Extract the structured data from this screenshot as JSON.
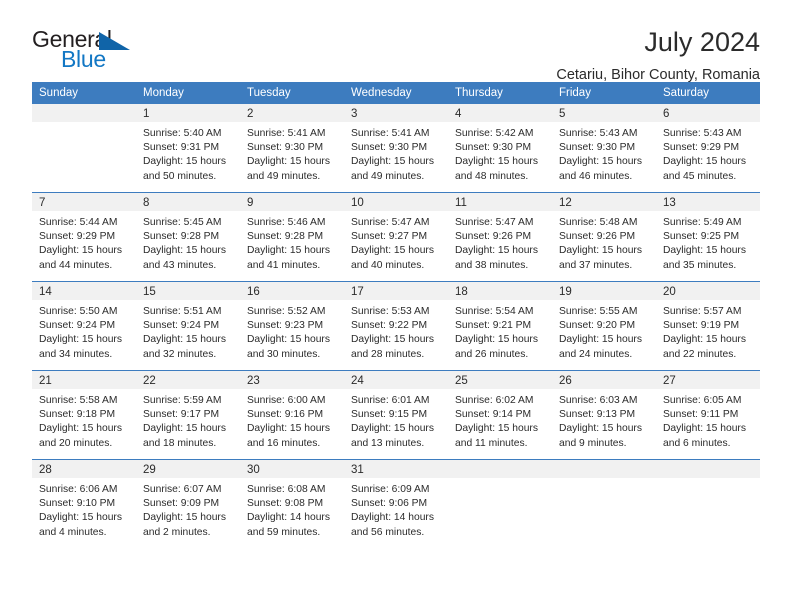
{
  "brand": {
    "name_part1": "General",
    "name_part2": "Blue",
    "accent_color": "#1277c4",
    "triangle_color": "#1064a8"
  },
  "header": {
    "title": "July 2024",
    "subtitle": "Cetariu, Bihor County, Romania"
  },
  "calendar": {
    "header_background": "#3d7cbf",
    "daynum_background": "#f1f1f1",
    "weekdays": [
      "Sunday",
      "Monday",
      "Tuesday",
      "Wednesday",
      "Thursday",
      "Friday",
      "Saturday"
    ],
    "weeks": [
      [
        {
          "day": "",
          "sunrise": "",
          "sunset": "",
          "daylight_line1": "",
          "daylight_line2": "",
          "empty": true
        },
        {
          "day": "1",
          "sunrise": "Sunrise: 5:40 AM",
          "sunset": "Sunset: 9:31 PM",
          "daylight_line1": "Daylight: 15 hours",
          "daylight_line2": "and 50 minutes."
        },
        {
          "day": "2",
          "sunrise": "Sunrise: 5:41 AM",
          "sunset": "Sunset: 9:30 PM",
          "daylight_line1": "Daylight: 15 hours",
          "daylight_line2": "and 49 minutes."
        },
        {
          "day": "3",
          "sunrise": "Sunrise: 5:41 AM",
          "sunset": "Sunset: 9:30 PM",
          "daylight_line1": "Daylight: 15 hours",
          "daylight_line2": "and 49 minutes."
        },
        {
          "day": "4",
          "sunrise": "Sunrise: 5:42 AM",
          "sunset": "Sunset: 9:30 PM",
          "daylight_line1": "Daylight: 15 hours",
          "daylight_line2": "and 48 minutes."
        },
        {
          "day": "5",
          "sunrise": "Sunrise: 5:43 AM",
          "sunset": "Sunset: 9:30 PM",
          "daylight_line1": "Daylight: 15 hours",
          "daylight_line2": "and 46 minutes."
        },
        {
          "day": "6",
          "sunrise": "Sunrise: 5:43 AM",
          "sunset": "Sunset: 9:29 PM",
          "daylight_line1": "Daylight: 15 hours",
          "daylight_line2": "and 45 minutes."
        }
      ],
      [
        {
          "day": "7",
          "sunrise": "Sunrise: 5:44 AM",
          "sunset": "Sunset: 9:29 PM",
          "daylight_line1": "Daylight: 15 hours",
          "daylight_line2": "and 44 minutes."
        },
        {
          "day": "8",
          "sunrise": "Sunrise: 5:45 AM",
          "sunset": "Sunset: 9:28 PM",
          "daylight_line1": "Daylight: 15 hours",
          "daylight_line2": "and 43 minutes."
        },
        {
          "day": "9",
          "sunrise": "Sunrise: 5:46 AM",
          "sunset": "Sunset: 9:28 PM",
          "daylight_line1": "Daylight: 15 hours",
          "daylight_line2": "and 41 minutes."
        },
        {
          "day": "10",
          "sunrise": "Sunrise: 5:47 AM",
          "sunset": "Sunset: 9:27 PM",
          "daylight_line1": "Daylight: 15 hours",
          "daylight_line2": "and 40 minutes."
        },
        {
          "day": "11",
          "sunrise": "Sunrise: 5:47 AM",
          "sunset": "Sunset: 9:26 PM",
          "daylight_line1": "Daylight: 15 hours",
          "daylight_line2": "and 38 minutes."
        },
        {
          "day": "12",
          "sunrise": "Sunrise: 5:48 AM",
          "sunset": "Sunset: 9:26 PM",
          "daylight_line1": "Daylight: 15 hours",
          "daylight_line2": "and 37 minutes."
        },
        {
          "day": "13",
          "sunrise": "Sunrise: 5:49 AM",
          "sunset": "Sunset: 9:25 PM",
          "daylight_line1": "Daylight: 15 hours",
          "daylight_line2": "and 35 minutes."
        }
      ],
      [
        {
          "day": "14",
          "sunrise": "Sunrise: 5:50 AM",
          "sunset": "Sunset: 9:24 PM",
          "daylight_line1": "Daylight: 15 hours",
          "daylight_line2": "and 34 minutes."
        },
        {
          "day": "15",
          "sunrise": "Sunrise: 5:51 AM",
          "sunset": "Sunset: 9:24 PM",
          "daylight_line1": "Daylight: 15 hours",
          "daylight_line2": "and 32 minutes."
        },
        {
          "day": "16",
          "sunrise": "Sunrise: 5:52 AM",
          "sunset": "Sunset: 9:23 PM",
          "daylight_line1": "Daylight: 15 hours",
          "daylight_line2": "and 30 minutes."
        },
        {
          "day": "17",
          "sunrise": "Sunrise: 5:53 AM",
          "sunset": "Sunset: 9:22 PM",
          "daylight_line1": "Daylight: 15 hours",
          "daylight_line2": "and 28 minutes."
        },
        {
          "day": "18",
          "sunrise": "Sunrise: 5:54 AM",
          "sunset": "Sunset: 9:21 PM",
          "daylight_line1": "Daylight: 15 hours",
          "daylight_line2": "and 26 minutes."
        },
        {
          "day": "19",
          "sunrise": "Sunrise: 5:55 AM",
          "sunset": "Sunset: 9:20 PM",
          "daylight_line1": "Daylight: 15 hours",
          "daylight_line2": "and 24 minutes."
        },
        {
          "day": "20",
          "sunrise": "Sunrise: 5:57 AM",
          "sunset": "Sunset: 9:19 PM",
          "daylight_line1": "Daylight: 15 hours",
          "daylight_line2": "and 22 minutes."
        }
      ],
      [
        {
          "day": "21",
          "sunrise": "Sunrise: 5:58 AM",
          "sunset": "Sunset: 9:18 PM",
          "daylight_line1": "Daylight: 15 hours",
          "daylight_line2": "and 20 minutes."
        },
        {
          "day": "22",
          "sunrise": "Sunrise: 5:59 AM",
          "sunset": "Sunset: 9:17 PM",
          "daylight_line1": "Daylight: 15 hours",
          "daylight_line2": "and 18 minutes."
        },
        {
          "day": "23",
          "sunrise": "Sunrise: 6:00 AM",
          "sunset": "Sunset: 9:16 PM",
          "daylight_line1": "Daylight: 15 hours",
          "daylight_line2": "and 16 minutes."
        },
        {
          "day": "24",
          "sunrise": "Sunrise: 6:01 AM",
          "sunset": "Sunset: 9:15 PM",
          "daylight_line1": "Daylight: 15 hours",
          "daylight_line2": "and 13 minutes."
        },
        {
          "day": "25",
          "sunrise": "Sunrise: 6:02 AM",
          "sunset": "Sunset: 9:14 PM",
          "daylight_line1": "Daylight: 15 hours",
          "daylight_line2": "and 11 minutes."
        },
        {
          "day": "26",
          "sunrise": "Sunrise: 6:03 AM",
          "sunset": "Sunset: 9:13 PM",
          "daylight_line1": "Daylight: 15 hours",
          "daylight_line2": "and 9 minutes."
        },
        {
          "day": "27",
          "sunrise": "Sunrise: 6:05 AM",
          "sunset": "Sunset: 9:11 PM",
          "daylight_line1": "Daylight: 15 hours",
          "daylight_line2": "and 6 minutes."
        }
      ],
      [
        {
          "day": "28",
          "sunrise": "Sunrise: 6:06 AM",
          "sunset": "Sunset: 9:10 PM",
          "daylight_line1": "Daylight: 15 hours",
          "daylight_line2": "and 4 minutes."
        },
        {
          "day": "29",
          "sunrise": "Sunrise: 6:07 AM",
          "sunset": "Sunset: 9:09 PM",
          "daylight_line1": "Daylight: 15 hours",
          "daylight_line2": "and 2 minutes."
        },
        {
          "day": "30",
          "sunrise": "Sunrise: 6:08 AM",
          "sunset": "Sunset: 9:08 PM",
          "daylight_line1": "Daylight: 14 hours",
          "daylight_line2": "and 59 minutes."
        },
        {
          "day": "31",
          "sunrise": "Sunrise: 6:09 AM",
          "sunset": "Sunset: 9:06 PM",
          "daylight_line1": "Daylight: 14 hours",
          "daylight_line2": "and 56 minutes."
        },
        {
          "day": "",
          "sunrise": "",
          "sunset": "",
          "daylight_line1": "",
          "daylight_line2": "",
          "empty": true
        },
        {
          "day": "",
          "sunrise": "",
          "sunset": "",
          "daylight_line1": "",
          "daylight_line2": "",
          "empty": true
        },
        {
          "day": "",
          "sunrise": "",
          "sunset": "",
          "daylight_line1": "",
          "daylight_line2": "",
          "empty": true
        }
      ]
    ]
  }
}
